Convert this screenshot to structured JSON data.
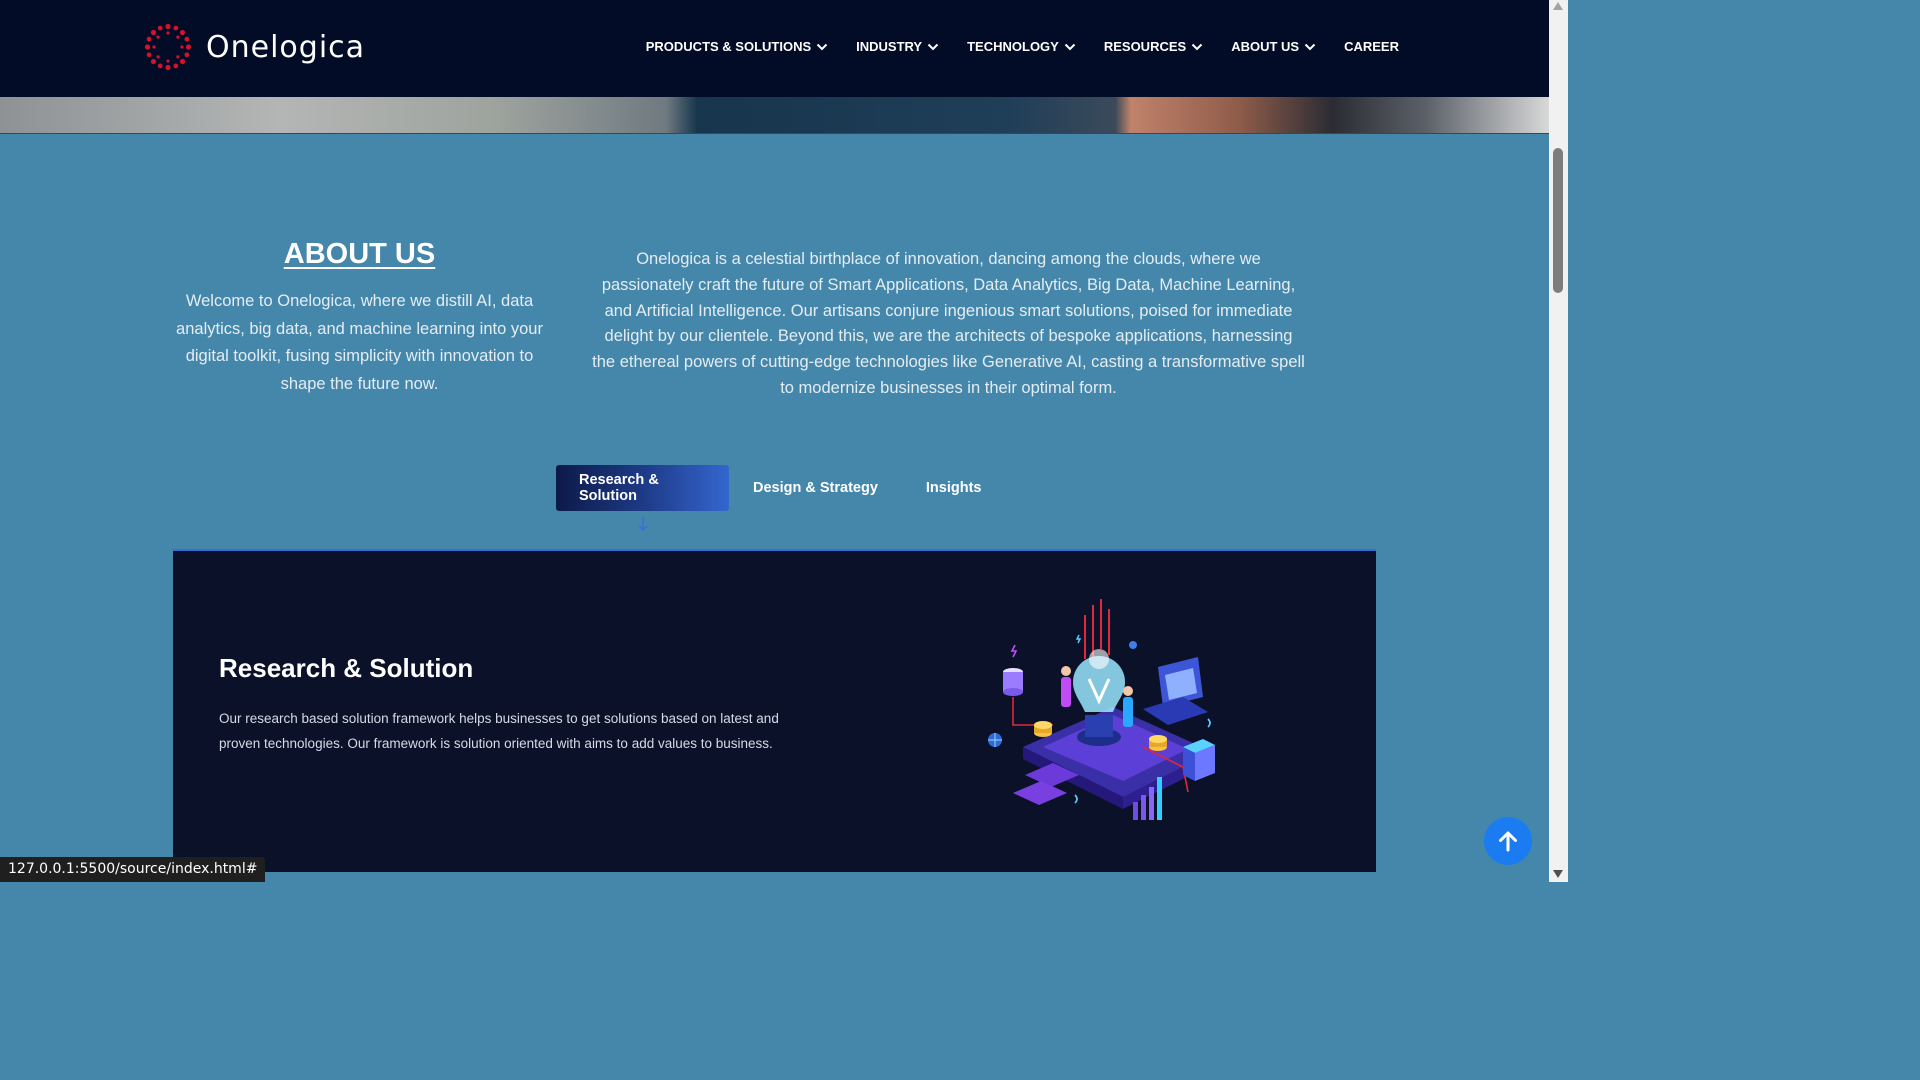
{
  "brand": {
    "name": "Onelogica",
    "logo_icon": "dotted-ring-logo",
    "accent": "#d6122a"
  },
  "nav": {
    "items": [
      {
        "label": "PRODUCTS & SOLUTIONS",
        "dropdown": true
      },
      {
        "label": "INDUSTRY",
        "dropdown": true
      },
      {
        "label": "TECHNOLOGY",
        "dropdown": true
      },
      {
        "label": "RESOURCES",
        "dropdown": true
      },
      {
        "label": "ABOUT US",
        "dropdown": true
      },
      {
        "label": "CAREER",
        "dropdown": false
      }
    ]
  },
  "about": {
    "title": "ABOUT US",
    "intro": "Welcome to Onelogica, where we distill AI, data analytics, big data, and machine learning into your digital toolkit, fusing simplicity with innovation to shape the future now.",
    "description": "Onelogica is a celestial birthplace of innovation, dancing among the clouds, where we passionately craft the future of Smart Applications, Data Analytics, Big Data, Machine Learning, and Artificial Intelligence. Our artisans conjure ingenious smart solutions, poised for immediate delight by our clientele. Beyond this, we are the architects of bespoke applications, harnessing the ethereal powers of cutting-edge technologies like Generative AI, casting a transformative spell to modernize businesses in their optimal form."
  },
  "tabs": [
    {
      "label": "Research & Solution",
      "active": true
    },
    {
      "label": "Design & Strategy",
      "active": false
    },
    {
      "label": "Insights",
      "active": false
    }
  ],
  "panel": {
    "title": "Research & Solution",
    "description": "Our research based solution framework helps businesses to get solutions based on latest and proven technologies. Our framework is solution oriented with aims to add values to business.",
    "illustration": "isometric-lightbulb-innovation-illustration"
  },
  "scroll_top_icon": "arrow-up-icon",
  "status_url": "127.0.0.1:5500/source/index.html#",
  "colors": {
    "navbar": "#030c27",
    "page_bg": "#4587ab",
    "panel_bg": "#0c112a",
    "button_blue": "#1a7cf0"
  }
}
